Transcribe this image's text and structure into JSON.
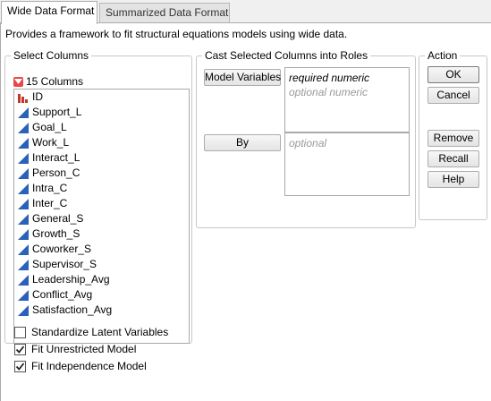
{
  "tabs": [
    {
      "label": "Wide Data Format",
      "active": true
    },
    {
      "label": "Summarized Data Format",
      "active": false
    }
  ],
  "description": "Provides a framework to fit structural equations models using wide data.",
  "select_columns": {
    "title": "Select Columns",
    "count_label": "15 Columns",
    "columns": [
      {
        "name": "ID",
        "icon": "nominal-bar-icon"
      },
      {
        "name": "Support_L",
        "icon": "continuous-icon"
      },
      {
        "name": "Goal_L",
        "icon": "continuous-icon"
      },
      {
        "name": "Work_L",
        "icon": "continuous-icon"
      },
      {
        "name": "Interact_L",
        "icon": "continuous-icon"
      },
      {
        "name": "Person_C",
        "icon": "continuous-icon"
      },
      {
        "name": "Intra_C",
        "icon": "continuous-icon"
      },
      {
        "name": "Inter_C",
        "icon": "continuous-icon"
      },
      {
        "name": "General_S",
        "icon": "continuous-icon"
      },
      {
        "name": "Growth_S",
        "icon": "continuous-icon"
      },
      {
        "name": "Coworker_S",
        "icon": "continuous-icon"
      },
      {
        "name": "Supervisor_S",
        "icon": "continuous-icon"
      },
      {
        "name": "Leadership_Avg",
        "icon": "continuous-icon"
      },
      {
        "name": "Conflict_Avg",
        "icon": "continuous-icon"
      },
      {
        "name": "Satisfaction_Avg",
        "icon": "continuous-icon"
      }
    ]
  },
  "cast_roles": {
    "title": "Cast Selected Columns into Roles",
    "model_variables": {
      "button": "Model Variables",
      "required": "required numeric",
      "optional": "optional numeric"
    },
    "by": {
      "button": "By",
      "optional": "optional"
    }
  },
  "action": {
    "title": "Action",
    "ok": "OK",
    "cancel": "Cancel",
    "remove": "Remove",
    "recall": "Recall",
    "help": "Help"
  },
  "options": [
    {
      "label": "Standardize Latent Variables",
      "checked": false
    },
    {
      "label": "Fit Unrestricted Model",
      "checked": true
    },
    {
      "label": "Fit Independence Model",
      "checked": true
    }
  ],
  "colors": {
    "continuous_icon": "#2962b8",
    "nominal_icon": "#c0392b",
    "menu_button": "#e84848"
  }
}
